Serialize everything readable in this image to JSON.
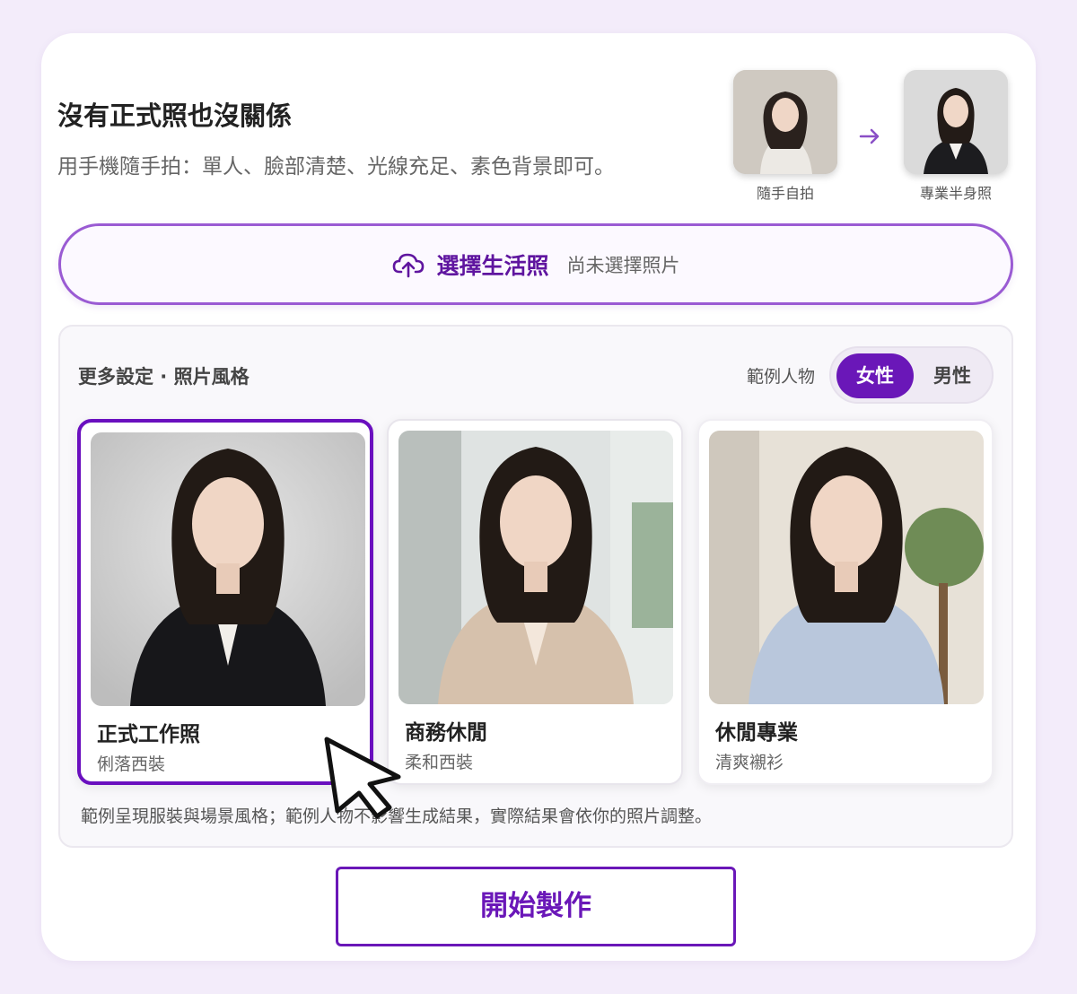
{
  "header": {
    "title": "沒有正式照也沒關係",
    "subtitle": "用手機隨手拍：單人、臉部清楚、光線充足、素色背景即可。"
  },
  "example": {
    "before_caption": "隨手自拍",
    "after_caption": "專業半身照"
  },
  "upload": {
    "label": "選擇生活照",
    "status": "尚未選擇照片"
  },
  "settings": {
    "title": "更多設定 · 照片風格",
    "sample_label": "範例人物",
    "gender_options": [
      "女性",
      "男性"
    ],
    "selected_gender": "女性",
    "styles": [
      {
        "name": "正式工作照",
        "desc": "俐落西裝",
        "selected": true
      },
      {
        "name": "商務休閒",
        "desc": "柔和西裝",
        "selected": false
      },
      {
        "name": "休閒專業",
        "desc": "清爽襯衫",
        "selected": false
      }
    ],
    "note": "範例呈現服裝與場景風格；範例人物不影響生成結果，實際結果會依你的照片調整。"
  },
  "actions": {
    "start_label": "開始製作"
  },
  "colors": {
    "accent": "#6a17b8",
    "page_bg": "#f3ecfa"
  }
}
